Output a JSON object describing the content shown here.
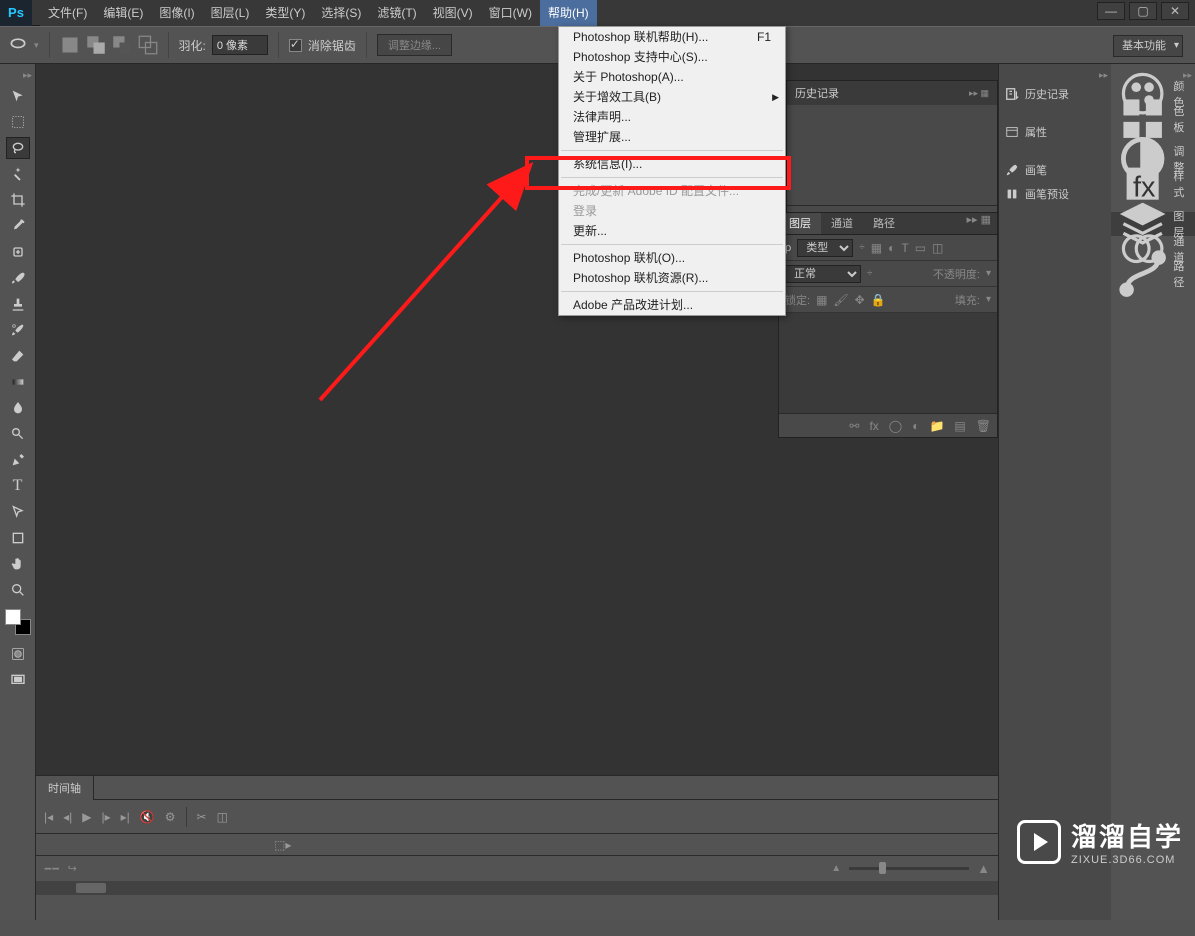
{
  "app": {
    "logo": "Ps"
  },
  "menus": [
    "文件(F)",
    "编辑(E)",
    "图像(I)",
    "图层(L)",
    "类型(Y)",
    "选择(S)",
    "滤镜(T)",
    "视图(V)",
    "窗口(W)",
    "帮助(H)"
  ],
  "win_controls": [
    "—",
    "▢",
    "✕"
  ],
  "optionbar": {
    "feather_label": "羽化:",
    "feather_value": "0 像素",
    "antialias": "消除锯齿",
    "refine": "调整边缘...",
    "workspace_dd": "基本功能"
  },
  "help_menu": [
    {
      "label": "Photoshop 联机帮助(H)...",
      "shortcut": "F1"
    },
    {
      "label": "Photoshop 支持中心(S)..."
    },
    {
      "label": "关于 Photoshop(A)..."
    },
    {
      "label": "关于增效工具(B)",
      "submenu": true
    },
    {
      "label": "法律声明..."
    },
    {
      "label": "管理扩展..."
    },
    {
      "sep": true
    },
    {
      "label": "系统信息(I)...",
      "highlight": true
    },
    {
      "sep": true
    },
    {
      "label": "完成/更新 Adobe ID 配置文件...",
      "disabled": true
    },
    {
      "label": "登录",
      "disabled": true
    },
    {
      "label": "更新..."
    },
    {
      "sep": true
    },
    {
      "label": "Photoshop 联机(O)..."
    },
    {
      "label": "Photoshop 联机资源(R)..."
    },
    {
      "sep": true
    },
    {
      "label": "Adobe 产品改进计划..."
    }
  ],
  "history_panel": {
    "tab": "历史记录"
  },
  "layers_panel": {
    "tabs": [
      "图层",
      "通道",
      "路径"
    ],
    "kind_label": "类型",
    "blend": "正常",
    "opacity_label": "不透明度:",
    "lock_label": "锁定:",
    "fill_label": "填充:"
  },
  "dock_left": [
    {
      "icon": "history-icon",
      "label": "历史记录"
    },
    {
      "icon": "properties-icon",
      "label": "属性"
    },
    {
      "icon": "brush-icon",
      "label": "画笔"
    },
    {
      "icon": "brush-presets-icon",
      "label": "画笔预设"
    }
  ],
  "dock_right": [
    {
      "icon": "color-icon",
      "label": "颜色"
    },
    {
      "icon": "swatches-icon",
      "label": "色板"
    },
    {
      "gap": true
    },
    {
      "icon": "adjustments-icon",
      "label": "调整"
    },
    {
      "icon": "styles-icon",
      "label": "样式"
    },
    {
      "gap": true
    },
    {
      "icon": "layers-icon",
      "label": "图层",
      "active": true
    },
    {
      "icon": "channels-icon",
      "label": "通道"
    },
    {
      "icon": "paths-icon",
      "label": "路径"
    }
  ],
  "timeline": {
    "tab": "时间轴"
  },
  "watermark": {
    "cn": "溜溜自学",
    "en": "ZIXUE.3D66.COM"
  },
  "lp_type_prefix": "ρ"
}
